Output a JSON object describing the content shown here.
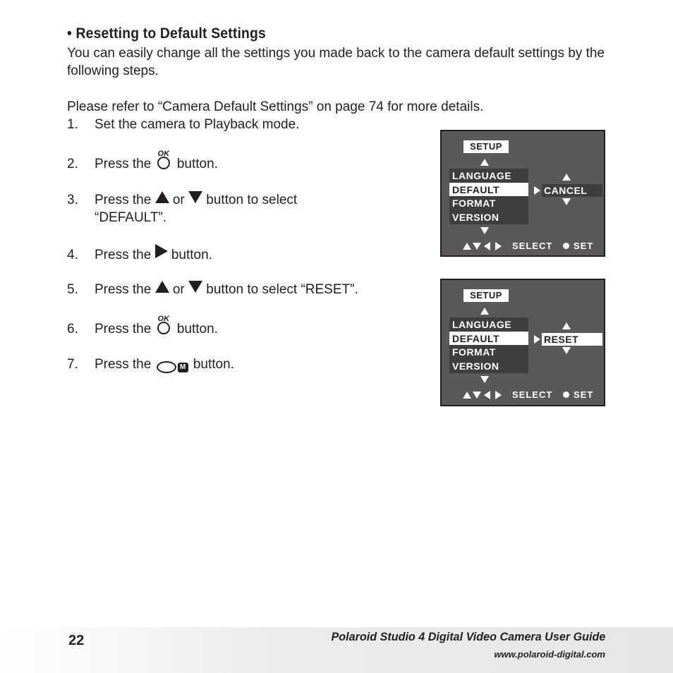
{
  "section": {
    "bullet": "•",
    "title": "Resetting to Default Settings",
    "intro": "You can easily change all the settings you made back to the camera default settings by the following steps.",
    "refer": "Please refer to “Camera Default Settings” on page 74 for more details."
  },
  "steps": [
    {
      "num": "1.",
      "pre": "Set the camera to Playback mode.",
      "post": ""
    },
    {
      "num": "2.",
      "pre": "Press the",
      "icon": "ok-button-icon",
      "post": "button."
    },
    {
      "num": "3.",
      "pre": "Press the",
      "icon": "up-arrow-icon",
      "mid": "or",
      "icon2": "down-arrow-icon",
      "post": "button to select",
      "cont": "“DEFAULT”."
    },
    {
      "num": "4.",
      "pre": "Press the",
      "icon": "right-arrow-icon",
      "post": "button."
    },
    {
      "num": "5.",
      "pre": "Press the",
      "icon": "up-arrow-icon",
      "mid": "or",
      "icon2": "down-arrow-icon",
      "post": "button to select “RESET”."
    },
    {
      "num": "6.",
      "pre": "Press the",
      "icon": "ok-button-icon",
      "post": "button."
    },
    {
      "num": "7.",
      "pre": "Press the",
      "icon": "menu-button-icon",
      "post": "button."
    }
  ],
  "icons": {
    "ok_label": "OK",
    "menu_key": "M"
  },
  "screens": [
    {
      "title": "SETUP",
      "menu": [
        "LANGUAGE",
        "DEFAULT",
        "FORMAT",
        "VERSION"
      ],
      "selected_index": 1,
      "option": "CANCEL",
      "option_highlighted": false,
      "hint_select": "SELECT",
      "hint_set": "SET"
    },
    {
      "title": "SETUP",
      "menu": [
        "LANGUAGE",
        "DEFAULT",
        "FORMAT",
        "VERSION"
      ],
      "selected_index": 1,
      "option": "RESET",
      "option_highlighted": true,
      "hint_select": "SELECT",
      "hint_set": "SET"
    }
  ],
  "footer": {
    "page_number": "22",
    "guide_title": "Polaroid Studio 4 Digital Video Camera User Guide",
    "website": "www.polaroid-digital.com"
  },
  "colors": {
    "text": "#231f20",
    "screen_bg": "#5a5859",
    "menu_bg": "#3f3d3e",
    "highlight": "#ffffff"
  }
}
